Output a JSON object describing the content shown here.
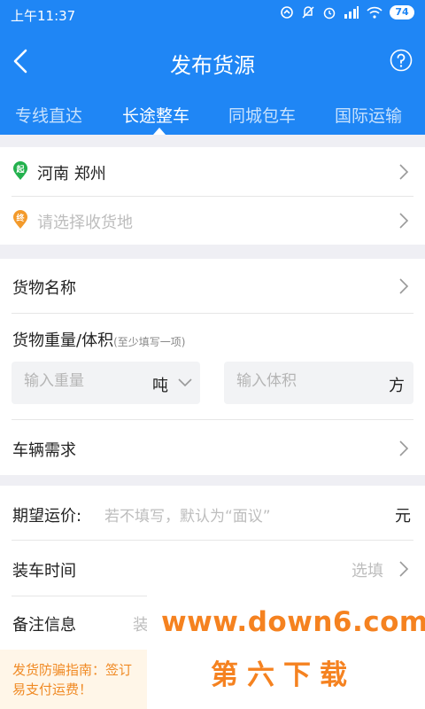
{
  "status": {
    "time": "上午11:37",
    "battery": "74",
    "icons": [
      "data-sync-icon",
      "mute-icon",
      "alarm-icon",
      "signal-icon",
      "wifi-icon"
    ]
  },
  "title": "发布货源",
  "tabs": [
    {
      "label": "专线直达",
      "active": false
    },
    {
      "label": "长途整车",
      "active": true
    },
    {
      "label": "同城包车",
      "active": false
    },
    {
      "label": "国际运输",
      "active": false
    }
  ],
  "route": {
    "origin_pin": "起",
    "origin": "河南 郑州",
    "dest_pin": "终",
    "dest_placeholder": "请选择收货地"
  },
  "cargo": {
    "name_label": "货物名称",
    "weight_volume_label": "货物重量/体积",
    "weight_volume_hint": "(至少填写一项)",
    "weight_placeholder": "输入重量",
    "weight_unit": "吨",
    "volume_placeholder": "输入体积",
    "volume_unit": "方",
    "vehicle_label": "车辆需求"
  },
  "price": {
    "label": "期望运价:",
    "placeholder": "若不填写，默认为“面议”",
    "unit": "元"
  },
  "loading": {
    "label": "装车时间",
    "value": "选填"
  },
  "notes": {
    "label": "备注信息",
    "partial_value": "装"
  },
  "footer": {
    "text": "发货防骗指南：签订 易支付运费！"
  },
  "watermark": {
    "url": "www.down6.com",
    "name": "第六下载"
  },
  "colors": {
    "primary": "#1f86f5",
    "origin_pin": "#23b14d",
    "dest_pin": "#f39a2b",
    "warning": "#f08a24"
  }
}
